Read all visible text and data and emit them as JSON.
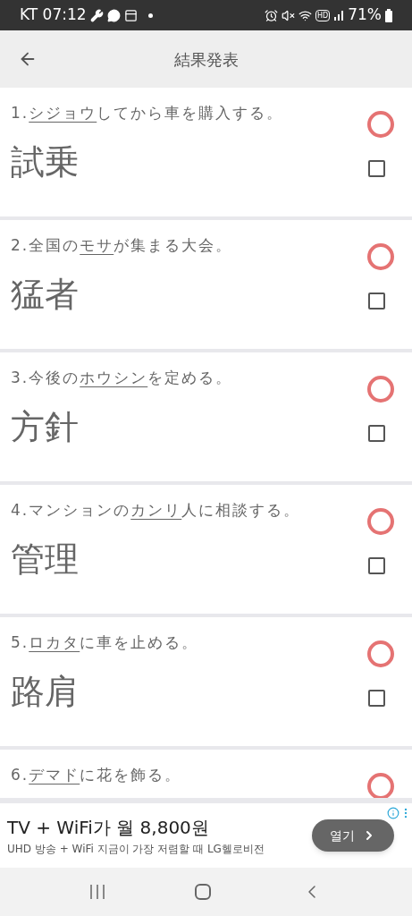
{
  "status_bar": {
    "carrier_time": "KT 07:12",
    "hd": "HD",
    "battery": "71%"
  },
  "header": {
    "title": "結果発表"
  },
  "questions": [
    {
      "number": "1.",
      "target": "シジョウ",
      "after": "してから車を購入する。",
      "answer": "試乗",
      "correct": true,
      "checked": false
    },
    {
      "number": "2.",
      "before": "全国の",
      "target": "モサ",
      "after": "が集まる大会。",
      "answer": "猛者",
      "correct": true,
      "checked": false
    },
    {
      "number": "3.",
      "before": "今後の",
      "target": "ホウシン",
      "after": "を定める。",
      "answer": "方針",
      "correct": true,
      "checked": false
    },
    {
      "number": "4.",
      "before": "マンションの",
      "target": "カンリ",
      "after": "人に相談する。",
      "answer": "管理",
      "correct": true,
      "checked": false
    },
    {
      "number": "5.",
      "target": "ロカタ",
      "after": "に車を止める。",
      "answer": "路肩",
      "correct": true,
      "checked": false
    },
    {
      "number": "6.",
      "target": "デマド",
      "after": "に花を飾る。",
      "correct": true
    }
  ],
  "ad": {
    "title": "TV + WiFi가 월 8,800원",
    "subtitle": "UHD 방송 + WiFi 지금이 가장 저렴할 때 LG헬로비전",
    "button": "열기"
  }
}
